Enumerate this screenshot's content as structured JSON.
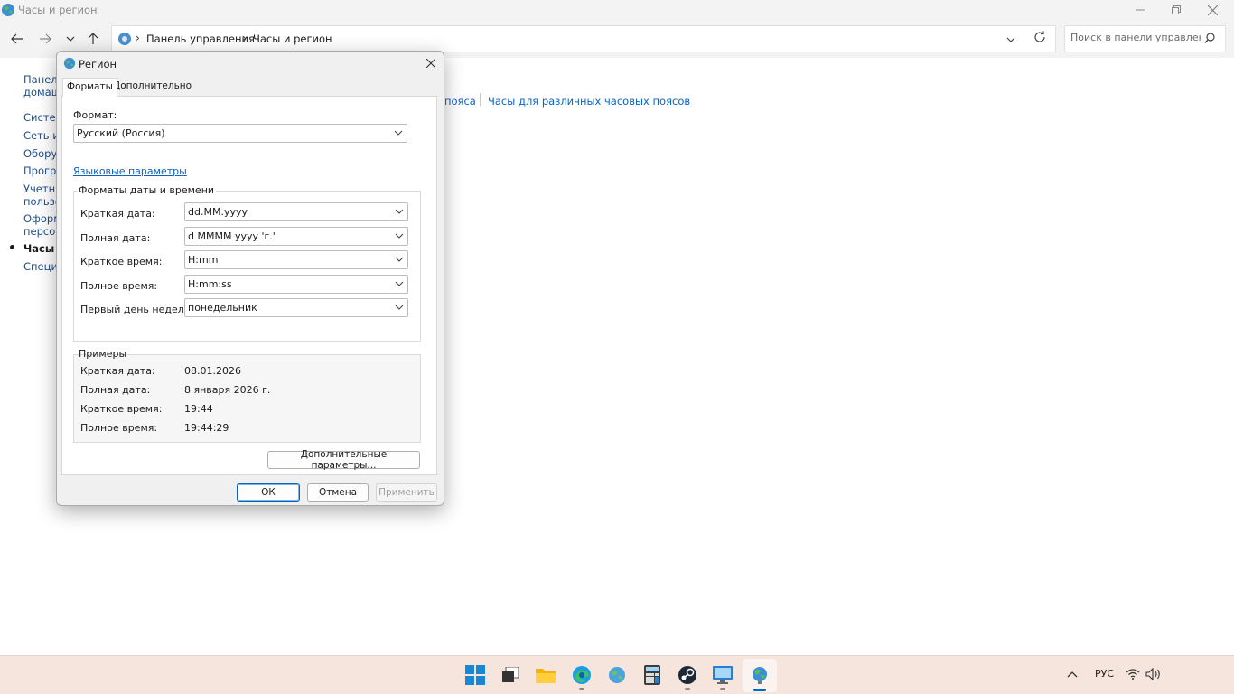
{
  "window": {
    "title": "Часы и регион",
    "search_placeholder": "Поиск в панели управлен..."
  },
  "breadcrumb": {
    "root": "Панель управления",
    "current": "Часы и регион"
  },
  "sidebar": {
    "items": [
      {
        "label": "Панель управления — домашняя страница",
        "line1": "Панель",
        "line2": "домаш"
      },
      {
        "label": "Система и безопасность",
        "line1": "Систем"
      },
      {
        "label": "Сеть и Интернет",
        "line1": "Сеть и I"
      },
      {
        "label": "Оборудование и звук",
        "line1": "Оборуд"
      },
      {
        "label": "Программы",
        "line1": "Програ"
      },
      {
        "label": "Учетные записи пользователей",
        "line1": "Учетны",
        "line2": "пользо"
      },
      {
        "label": "Оформление и персонализация",
        "line1": "Оформ",
        "line2": "персон"
      },
      {
        "label": "Часы и регион",
        "line1": "Часы и",
        "current": true
      },
      {
        "label": "Специальные возможности",
        "line1": "Специа"
      }
    ]
  },
  "main": {
    "link_partial": "пояса",
    "link_clocks": "Часы для различных часовых поясов"
  },
  "dialog": {
    "title": "Регион",
    "tabs": [
      "Форматы",
      "Дополнительно"
    ],
    "format_label": "Формат:",
    "format_value": "Русский (Россия)",
    "language_link": "Языковые параметры",
    "group_title": "Форматы даты и времени",
    "rows": [
      {
        "label": "Краткая дата:",
        "value": "dd.MM.yyyy"
      },
      {
        "label": "Полная дата:",
        "value": "d MMMM yyyy 'г.'"
      },
      {
        "label": "Краткое время:",
        "value": "H:mm"
      },
      {
        "label": "Полное время:",
        "value": "H:mm:ss"
      },
      {
        "label": "Первый день недели:",
        "value": "понедельник"
      }
    ],
    "examples_title": "Примеры",
    "examples": [
      {
        "label": "Краткая дата:",
        "value": "08.01.2026"
      },
      {
        "label": "Полная дата:",
        "value": "8 января 2026 г."
      },
      {
        "label": "Краткое время:",
        "value": "19:44"
      },
      {
        "label": "Полное время:",
        "value": "19:44:29"
      }
    ],
    "additional_button": "Дополнительные параметры...",
    "ok": "ОК",
    "cancel": "Отмена",
    "apply": "Применить"
  },
  "taskbar": {
    "apps": [
      "start-icon",
      "task-view-icon",
      "file-explorer-icon",
      "edge-icon",
      "network-globe-icon",
      "calculator-icon",
      "steam-icon",
      "remote-desktop-icon",
      "region-globe-icon"
    ],
    "language": "РУС"
  }
}
